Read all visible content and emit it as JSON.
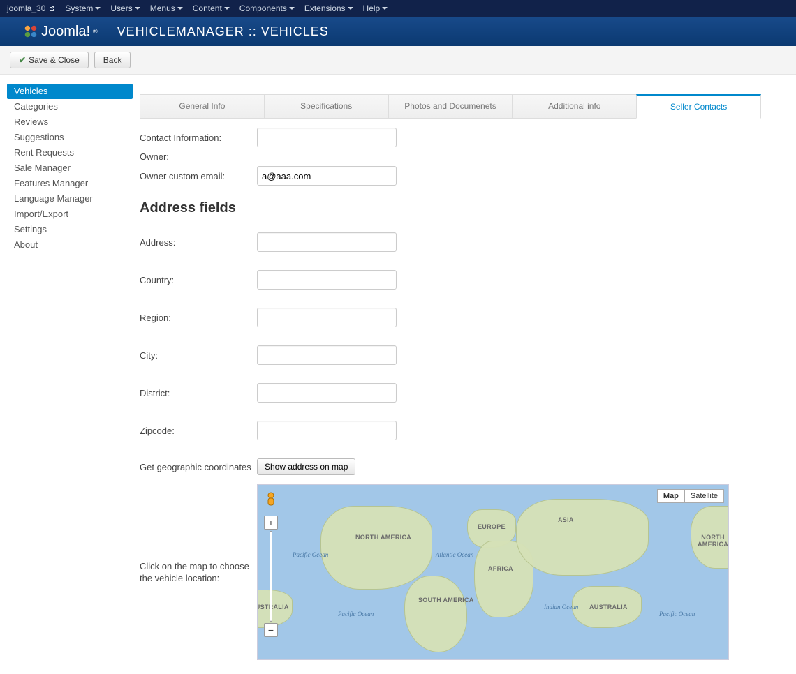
{
  "topbar": {
    "site": "joomla_30",
    "menus": [
      "System",
      "Users",
      "Menus",
      "Content",
      "Components",
      "Extensions",
      "Help"
    ]
  },
  "header": {
    "brand": "Joomla!",
    "title": "VEHICLEMANAGER :: VEHICLES"
  },
  "toolbar": {
    "save_close": "Save & Close",
    "back": "Back"
  },
  "sidebar": {
    "items": [
      "Vehicles",
      "Categories",
      "Reviews",
      "Suggestions",
      "Rent Requests",
      "Sale Manager",
      "Features Manager",
      "Language Manager",
      "Import/Export",
      "Settings",
      "About"
    ],
    "active_index": 0
  },
  "tabs": {
    "items": [
      "General Info",
      "Specifications",
      "Photos and Documenets",
      "Additional info",
      "Seller Contacts"
    ],
    "active_index": 4
  },
  "form": {
    "contact_info_label": "Contact Information:",
    "contact_info_value": "",
    "owner_label": "Owner:",
    "owner_email_label": "Owner custom email:",
    "owner_email_value": "a@aaa.com",
    "address_section": "Address fields",
    "address_label": "Address:",
    "address_value": "",
    "country_label": "Country:",
    "country_value": "",
    "region_label": "Region:",
    "region_value": "",
    "city_label": "City:",
    "city_value": "",
    "district_label": "District:",
    "district_value": "",
    "zipcode_label": "Zipcode:",
    "zipcode_value": "",
    "geo_label": "Get geographic coordinates",
    "geo_button": "Show address on map",
    "map_click_label": "Click on the map to choose the vehicle location:"
  },
  "map": {
    "type_map": "Map",
    "type_satellite": "Satellite",
    "labels": {
      "north_america": "North America",
      "south_america": "South America",
      "europe": "Europe",
      "africa": "Africa",
      "asia": "Asia",
      "australia": "Australia",
      "north_america2": "North America",
      "atlantic": "Atlantic Ocean",
      "pacific1": "Pacific Ocean",
      "pacific2": "Pacific Ocean",
      "pacific3": "Pacific Ocean",
      "indian": "Indian Ocean"
    }
  }
}
